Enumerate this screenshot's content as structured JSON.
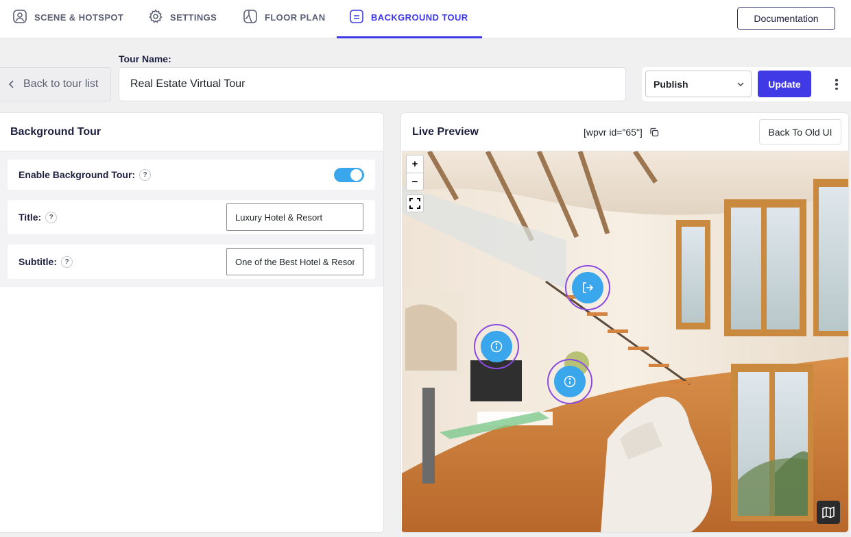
{
  "nav": {
    "tabs": [
      {
        "label": "SCENE & HOTSPOT",
        "icon": "scene-icon"
      },
      {
        "label": "SETTINGS",
        "icon": "gear-icon"
      },
      {
        "label": "FLOOR PLAN",
        "icon": "floor-plan-icon"
      },
      {
        "label": "BACKGROUND TOUR",
        "icon": "background-tour-icon",
        "active": true
      }
    ],
    "documentation_label": "Documentation"
  },
  "tour": {
    "back_label": "Back to tour list",
    "name_label": "Tour Name:",
    "name_value": "Real Estate Virtual Tour",
    "status_selected": "Publish",
    "update_label": "Update"
  },
  "background_tour": {
    "header": "Background Tour",
    "enable_label": "Enable Background Tour:",
    "enabled": true,
    "title_label": "Title:",
    "title_value": "Luxury Hotel & Resort",
    "subtitle_label": "Subtitle:",
    "subtitle_value": "One of the Best Hotel & Resort",
    "help_glyph": "?"
  },
  "preview": {
    "title": "Live Preview",
    "shortcode": "[wpvr id=\"65\"]",
    "old_ui_label": "Back To Old UI",
    "zoom_in": "+",
    "zoom_out": "−",
    "hotspots": [
      {
        "type": "scene-link",
        "icon": "exit-icon"
      },
      {
        "type": "info",
        "icon": "info-icon"
      },
      {
        "type": "info",
        "icon": "info-icon"
      }
    ]
  },
  "colors": {
    "accent": "#3f39e6",
    "toggle_on": "#3aa6ec",
    "hotspot_fill": "#3aa6ec",
    "hotspot_ring": "#8a4be0"
  }
}
